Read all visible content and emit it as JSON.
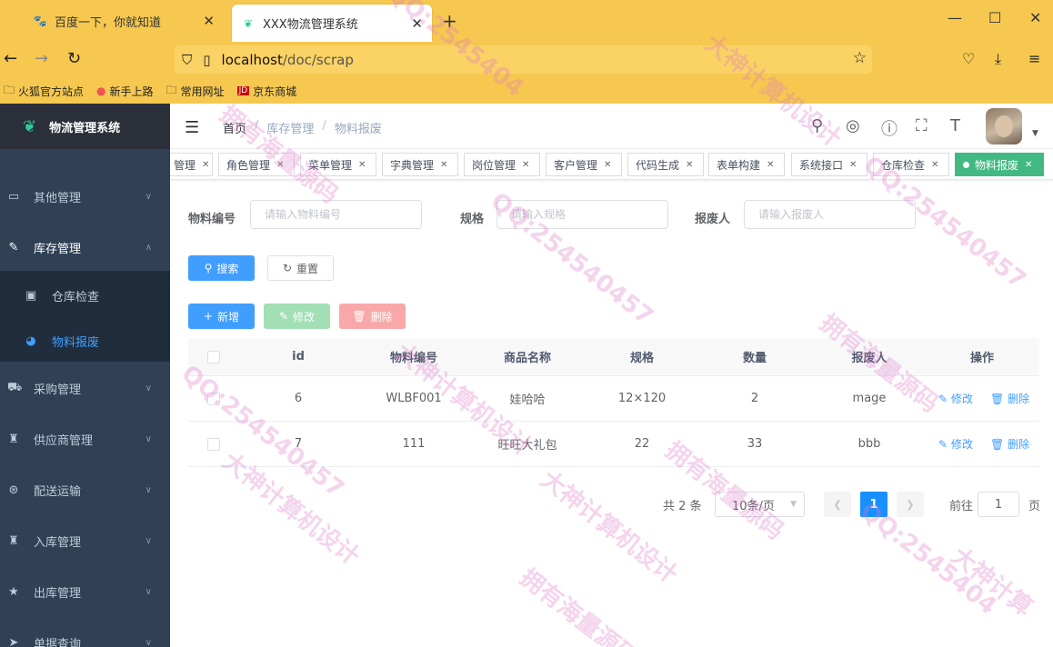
{
  "browser": {
    "tabs": [
      {
        "title": "百度一下，你就知道",
        "icon": "baidu-icon"
      },
      {
        "title": "XXX物流管理系统",
        "icon": "app-leaf-icon"
      }
    ],
    "url_host": "localhost",
    "url_path": "/doc/scrap",
    "bookmarks": [
      "火狐官方站点",
      "新手上路",
      "常用网址",
      "京东商城"
    ]
  },
  "app": {
    "title": "物流管理系统",
    "accent": "#409eff",
    "tag_active_color": "#42b983"
  },
  "sidebar": {
    "items": [
      {
        "label": "其他管理",
        "icon": "box-icon"
      },
      {
        "label": "库存管理",
        "icon": "edit-icon"
      },
      {
        "label": "采购管理",
        "icon": "cart-icon"
      },
      {
        "label": "供应商管理",
        "icon": "shirt-icon"
      },
      {
        "label": "配送运输",
        "icon": "lifebuoy-icon"
      },
      {
        "label": "入库管理",
        "icon": "shirt-icon"
      },
      {
        "label": "出库管理",
        "icon": "star-icon"
      },
      {
        "label": "单据查询",
        "icon": "send-icon"
      }
    ],
    "sub_items": [
      {
        "label": "仓库检查",
        "icon": "message-icon"
      },
      {
        "label": "物料报废",
        "icon": "dashboard-icon"
      }
    ]
  },
  "breadcrumb": [
    "首页",
    "库存管理",
    "物料报废"
  ],
  "tags": [
    {
      "label": "管理"
    },
    {
      "label": "角色管理"
    },
    {
      "label": "菜单管理"
    },
    {
      "label": "字典管理"
    },
    {
      "label": "岗位管理"
    },
    {
      "label": "客户管理"
    },
    {
      "label": "代码生成"
    },
    {
      "label": "表单构建"
    },
    {
      "label": "系统接口"
    },
    {
      "label": "仓库检查"
    },
    {
      "label": "物料报废"
    }
  ],
  "search": {
    "fields": [
      {
        "label": "物料编号",
        "placeholder": "请输入物料编号"
      },
      {
        "label": "规格",
        "placeholder": "请输入规格"
      },
      {
        "label": "报废人",
        "placeholder": "请输入报废人"
      }
    ],
    "search_label": "搜索",
    "reset_label": "重置"
  },
  "toolbar": {
    "add_label": "新增",
    "edit_label": "修改",
    "delete_label": "删除"
  },
  "table": {
    "columns": [
      "id",
      "物料编号",
      "商品名称",
      "规格",
      "数量",
      "报废人",
      "操作"
    ],
    "rows": [
      {
        "id": "6",
        "code": "WLBF001",
        "name": "娃哈哈",
        "spec": "12×120",
        "qty": "2",
        "person": "mage"
      },
      {
        "id": "7",
        "code": "111",
        "name": "旺旺大礼包",
        "spec": "22",
        "qty": "33",
        "person": "bbb"
      }
    ],
    "row_edit": "修改",
    "row_delete": "删除"
  },
  "pagination": {
    "total_text": "共 2 条",
    "page_size": "10条/页",
    "current_page": "1",
    "goto_label": "前往",
    "goto_value": "1",
    "page_unit": "页"
  },
  "watermarks": [
    "QQ:2545404",
    "大神计算机设计",
    "拥有海量源码",
    "QQ:254540457",
    "大神计算机设计",
    "拥有海量源码",
    "QQ:254540457",
    "大神计算机设计",
    "拥有海量源码",
    "QQ:254540457",
    "大神计算机设计",
    "拥有海量源码",
    "QQ:2545404",
    "大神计算"
  ]
}
